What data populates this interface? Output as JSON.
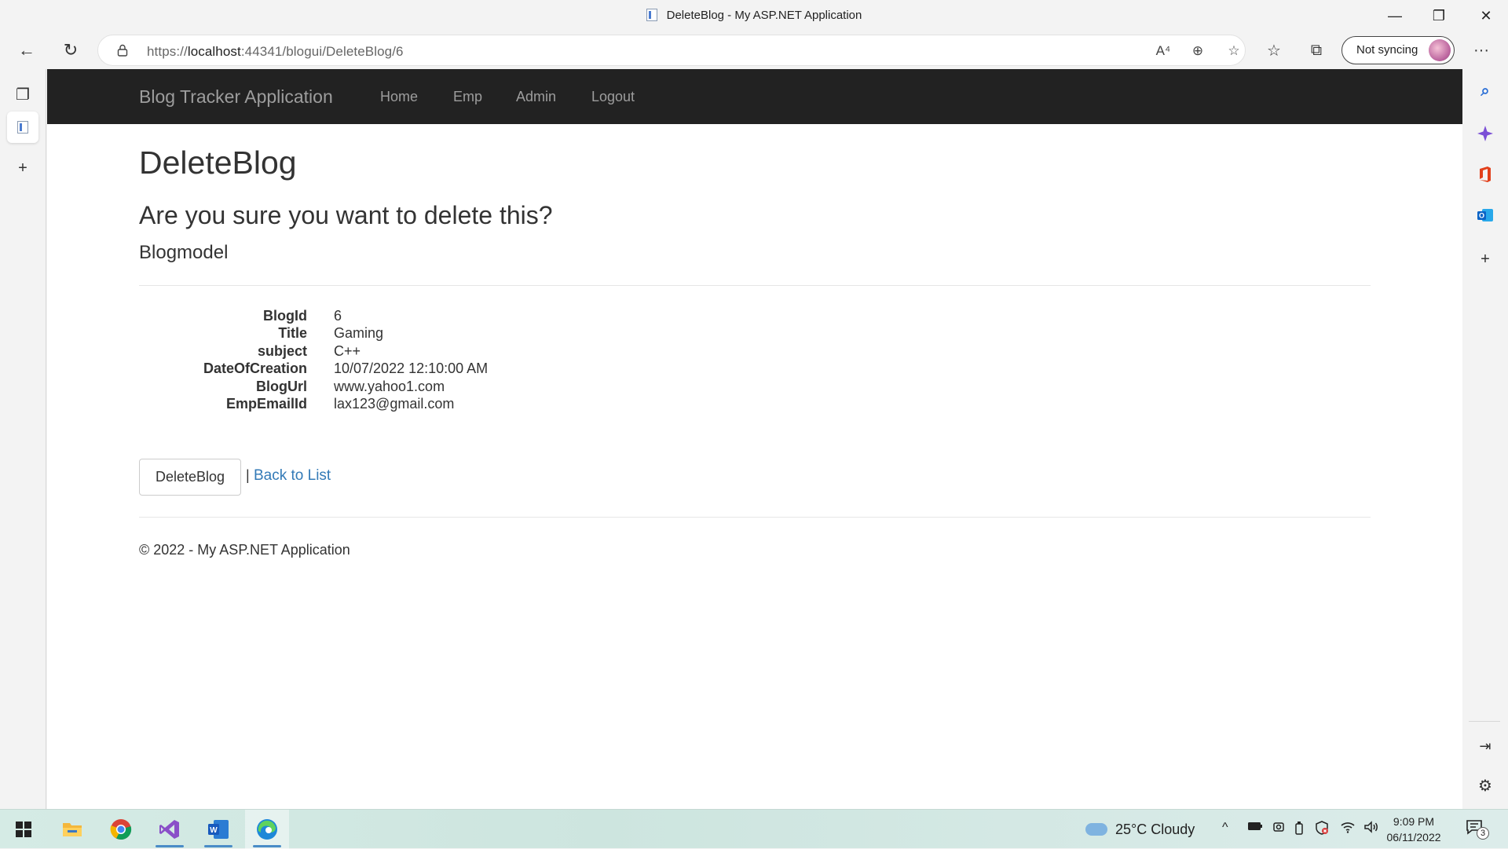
{
  "window": {
    "title": "DeleteBlog - My ASP.NET Application",
    "minimize_glyph": "—",
    "maximize_glyph": "❐",
    "close_glyph": "✕"
  },
  "browser": {
    "back_glyph": "←",
    "refresh_glyph": "↻",
    "url_scheme": "https://",
    "url_host": "localhost",
    "url_rest": ":44341/blogui/DeleteBlog/6",
    "read_aloud_glyph": "A⁴",
    "zoom_glyph": "⊕",
    "add_favorite_glyph": "☆",
    "favorites_glyph": "☆",
    "collections_glyph": "⧉",
    "sync_label": "Not syncing",
    "more_glyph": "···"
  },
  "left_strip": {
    "tab_actions_glyph": "❐",
    "add_tab_glyph": "+"
  },
  "right_strip": {
    "search_glyph": "⌕",
    "add_glyph": "+",
    "hide_sidebar_glyph": "⇥",
    "settings_glyph": "⚙"
  },
  "site": {
    "brand": "Blog Tracker Application",
    "nav": {
      "home": "Home",
      "emp": "Emp",
      "admin": "Admin",
      "logout": "Logout"
    }
  },
  "page": {
    "title": "DeleteBlog",
    "confirm": "Are you sure you want to delete this?",
    "model": "Blogmodel",
    "details": [
      {
        "label": "BlogId",
        "value": "6"
      },
      {
        "label": "Title",
        "value": "Gaming"
      },
      {
        "label": "subject",
        "value": "C++"
      },
      {
        "label": "DateOfCreation",
        "value": "10/07/2022 12:10:00 AM"
      },
      {
        "label": "BlogUrl",
        "value": "www.yahoo1.com"
      },
      {
        "label": "EmpEmailId",
        "value": "lax123@gmail.com"
      }
    ],
    "delete_button": "DeleteBlog",
    "separator": "|",
    "back_link": "Back to List",
    "footer": "© 2022 - My ASP.NET Application"
  },
  "taskbar": {
    "weather": "25°C  Cloudy",
    "time": "9:09 PM",
    "date": "06/11/2022",
    "notification_count": "3",
    "chevron_glyph": "^"
  },
  "colors": {
    "navbar_bg": "#222222",
    "nav_text": "#9d9d9d",
    "link": "#337ab7"
  }
}
